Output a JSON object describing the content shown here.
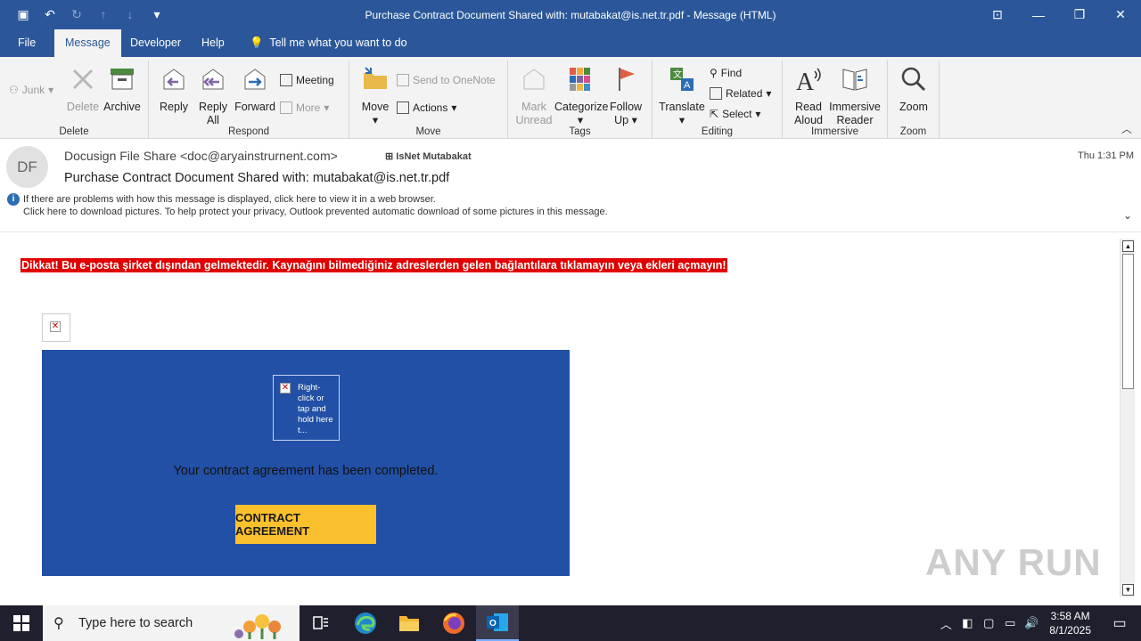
{
  "window": {
    "title": "Purchase Contract Document Shared with: mutabakat@is.net.tr.pdf  -  Message (HTML)"
  },
  "tabs": [
    "File",
    "Message",
    "Developer",
    "Help"
  ],
  "tell_me": "Tell me what you want to do",
  "ribbon": {
    "delete_group": {
      "label": "Delete",
      "junk": "Junk",
      "delete": "Delete",
      "archive": "Archive"
    },
    "respond_group": {
      "label": "Respond",
      "reply": "Reply",
      "reply_all_1": "Reply",
      "reply_all_2": "All",
      "forward": "Forward",
      "meeting": "Meeting",
      "more": "More"
    },
    "move_group": {
      "label": "Move",
      "move": "Move",
      "onenote": "Send to OneNote",
      "actions": "Actions"
    },
    "tags_group": {
      "label": "Tags",
      "mark_unread_1": "Mark",
      "mark_unread_2": "Unread",
      "categorize": "Categorize",
      "follow_up_1": "Follow",
      "follow_up_2": "Up"
    },
    "editing_group": {
      "label": "Editing",
      "translate": "Translate",
      "find": "Find",
      "related": "Related",
      "select": "Select"
    },
    "immersive_group": {
      "label": "Immersive",
      "read_aloud_1": "Read",
      "read_aloud_2": "Aloud",
      "immersive_reader_1": "Immersive",
      "immersive_reader_2": "Reader"
    },
    "zoom_group": {
      "label": "Zoom",
      "zoom": "Zoom"
    }
  },
  "message": {
    "avatar_initials": "DF",
    "from": "Docusign File Share <doc@aryainstrurnent.com>",
    "to_label": "IsNet Mutabakat",
    "date": "Thu 1:31 PM",
    "subject": "Purchase Contract Document Shared with: mutabakat@is.net.tr.pdf",
    "info_line_1": "If there are problems with how this message is displayed, click here to view it in a web browser.",
    "info_line_2": "Click here to download pictures. To help protect your privacy, Outlook prevented automatic download of some pictures in this message."
  },
  "body": {
    "warning": "Dikkat! Bu e-posta şirket dışından gelmektedir. Kaynağını bilmediğiniz adreslerden gelen bağlantılara tıklamayın veya ekleri açmayın!",
    "image_placeholder": "Right-click or tap and hold here t...",
    "completed_text": "Your contract agreement has been completed.",
    "cta_label": "CONTRACT AGREEMENT",
    "panel_color": "#2250a6",
    "cta_color": "#fbc02d"
  },
  "watermark": "ANY RUN",
  "taskbar": {
    "search_placeholder": "Type here to search",
    "time": "3:58 AM",
    "date": "8/1/2025"
  }
}
